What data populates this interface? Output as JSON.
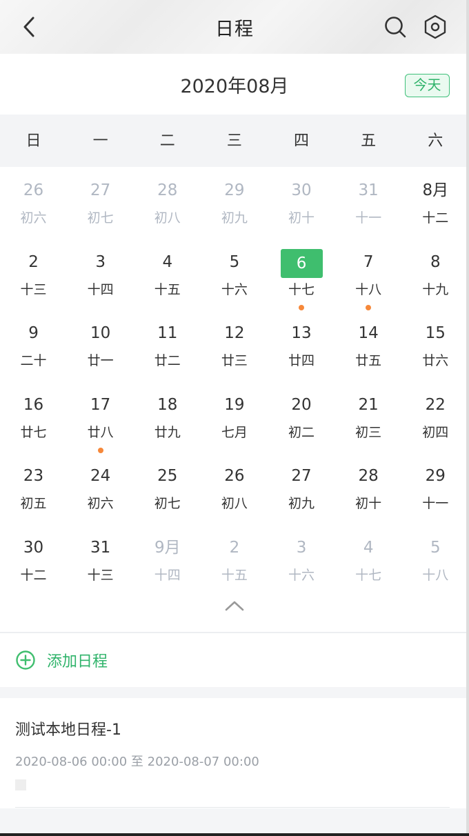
{
  "header": {
    "title": "日程",
    "back_icon": "chevron-left-icon",
    "search_icon": "search-icon",
    "settings_icon": "hexagon-settings-icon"
  },
  "month_bar": {
    "month": "2020年08月",
    "today_button": "今天"
  },
  "weekdays": [
    "日",
    "一",
    "二",
    "三",
    "四",
    "五",
    "六"
  ],
  "calendar": {
    "weeks": [
      [
        {
          "num": "26",
          "lunar": "初六",
          "muted": true
        },
        {
          "num": "27",
          "lunar": "初七",
          "muted": true
        },
        {
          "num": "28",
          "lunar": "初八",
          "muted": true
        },
        {
          "num": "29",
          "lunar": "初九",
          "muted": true
        },
        {
          "num": "30",
          "lunar": "初十",
          "muted": true
        },
        {
          "num": "31",
          "lunar": "十一",
          "muted": true
        },
        {
          "num": "8月",
          "lunar": "十二",
          "muted": false
        }
      ],
      [
        {
          "num": "2",
          "lunar": "十三",
          "muted": false
        },
        {
          "num": "3",
          "lunar": "十四",
          "muted": false
        },
        {
          "num": "4",
          "lunar": "十五",
          "muted": false
        },
        {
          "num": "5",
          "lunar": "十六",
          "muted": false
        },
        {
          "num": "6",
          "lunar": "十七",
          "muted": false,
          "selected": true,
          "has_event": true
        },
        {
          "num": "7",
          "lunar": "十八",
          "muted": false,
          "has_event": true
        },
        {
          "num": "8",
          "lunar": "十九",
          "muted": false
        }
      ],
      [
        {
          "num": "9",
          "lunar": "二十",
          "muted": false
        },
        {
          "num": "10",
          "lunar": "廿一",
          "muted": false
        },
        {
          "num": "11",
          "lunar": "廿二",
          "muted": false
        },
        {
          "num": "12",
          "lunar": "廿三",
          "muted": false
        },
        {
          "num": "13",
          "lunar": "廿四",
          "muted": false
        },
        {
          "num": "14",
          "lunar": "廿五",
          "muted": false
        },
        {
          "num": "15",
          "lunar": "廿六",
          "muted": false
        }
      ],
      [
        {
          "num": "16",
          "lunar": "廿七",
          "muted": false
        },
        {
          "num": "17",
          "lunar": "廿八",
          "muted": false,
          "has_event": true
        },
        {
          "num": "18",
          "lunar": "廿九",
          "muted": false
        },
        {
          "num": "19",
          "lunar": "七月",
          "muted": false
        },
        {
          "num": "20",
          "lunar": "初二",
          "muted": false
        },
        {
          "num": "21",
          "lunar": "初三",
          "muted": false
        },
        {
          "num": "22",
          "lunar": "初四",
          "muted": false
        }
      ],
      [
        {
          "num": "23",
          "lunar": "初五",
          "muted": false
        },
        {
          "num": "24",
          "lunar": "初六",
          "muted": false
        },
        {
          "num": "25",
          "lunar": "初七",
          "muted": false
        },
        {
          "num": "26",
          "lunar": "初八",
          "muted": false
        },
        {
          "num": "27",
          "lunar": "初九",
          "muted": false
        },
        {
          "num": "28",
          "lunar": "初十",
          "muted": false
        },
        {
          "num": "29",
          "lunar": "十一",
          "muted": false
        }
      ],
      [
        {
          "num": "30",
          "lunar": "十二",
          "muted": false
        },
        {
          "num": "31",
          "lunar": "十三",
          "muted": false
        },
        {
          "num": "9月",
          "lunar": "十四",
          "muted": true
        },
        {
          "num": "2",
          "lunar": "十五",
          "muted": true
        },
        {
          "num": "3",
          "lunar": "十六",
          "muted": true
        },
        {
          "num": "4",
          "lunar": "十七",
          "muted": true
        },
        {
          "num": "5",
          "lunar": "十八",
          "muted": true
        }
      ]
    ],
    "collapse_icon": "chevron-up-icon"
  },
  "add_event": {
    "icon": "plus-circle-icon",
    "label": "添加日程"
  },
  "events": [
    {
      "name": "测试本地日程-1",
      "time": "2020-08-06 00:00 至 2020-08-07 00:00"
    }
  ],
  "colors": {
    "accent_green": "#3fbe6e",
    "event_dot": "#f6883a",
    "muted_text": "#b0b7c2"
  }
}
